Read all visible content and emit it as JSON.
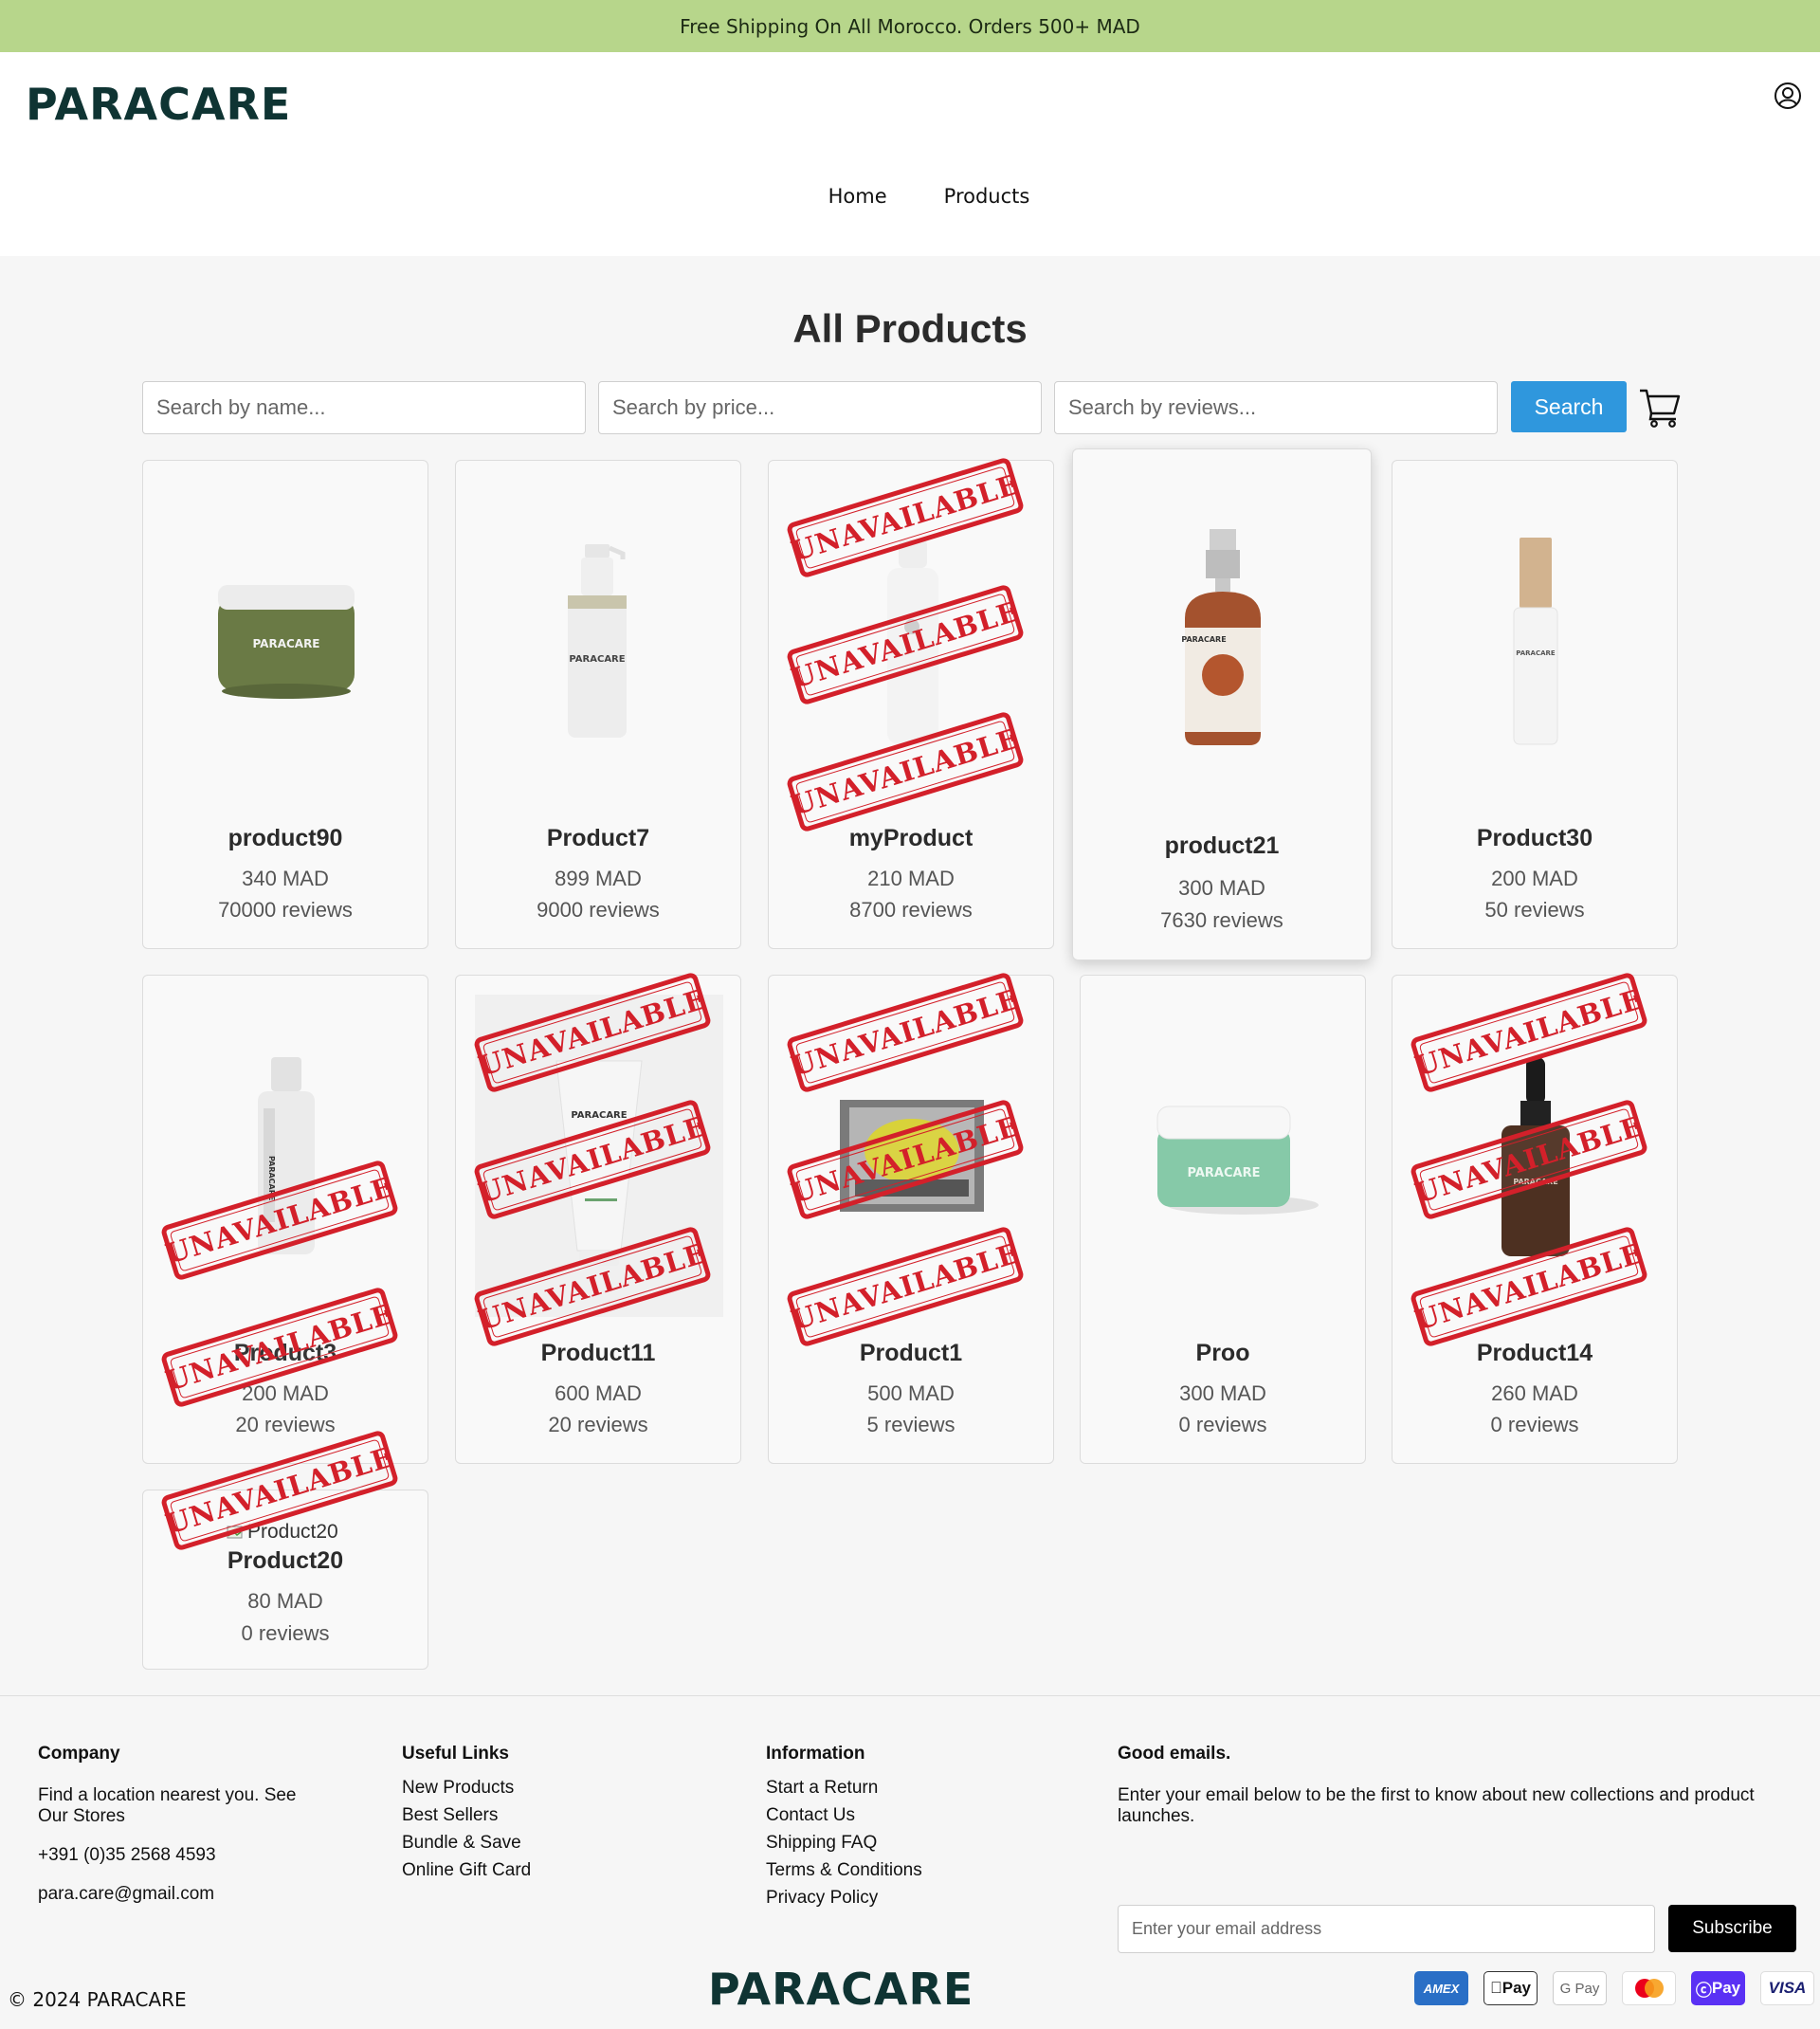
{
  "announcement": "Free Shipping On All Morocco. Orders 500+ MAD",
  "brand": {
    "logo_text": "PARACARE"
  },
  "nav": {
    "home": "Home",
    "products": "Products"
  },
  "page_title": "All Products",
  "search": {
    "name_placeholder": "Search by name...",
    "price_placeholder": "Search by price...",
    "reviews_placeholder": "Search by reviews...",
    "button": "Search"
  },
  "stamp_text": "UNAVAILABLE",
  "products": [
    {
      "name": "product90",
      "price": "340 MAD",
      "reviews": "70000 reviews",
      "unavailable": false
    },
    {
      "name": "Product7",
      "price": "899 MAD",
      "reviews": "9000 reviews",
      "unavailable": false
    },
    {
      "name": "myProduct",
      "price": "210 MAD",
      "reviews": "8700 reviews",
      "unavailable": true
    },
    {
      "name": "product21",
      "price": "300 MAD",
      "reviews": "7630 reviews",
      "unavailable": false
    },
    {
      "name": "Product30",
      "price": "200 MAD",
      "reviews": "50 reviews",
      "unavailable": false
    },
    {
      "name": "Product3",
      "price": "200 MAD",
      "reviews": "20 reviews",
      "unavailable": true
    },
    {
      "name": "Product11",
      "price": "600 MAD",
      "reviews": "20 reviews",
      "unavailable": true
    },
    {
      "name": "Product1",
      "price": "500 MAD",
      "reviews": "5 reviews",
      "unavailable": true
    },
    {
      "name": "Proo",
      "price": "300 MAD",
      "reviews": "0 reviews",
      "unavailable": false
    },
    {
      "name": "Product14",
      "price": "260 MAD",
      "reviews": "0 reviews",
      "unavailable": true
    },
    {
      "name": "Product20",
      "price": "80 MAD",
      "reviews": "0 reviews",
      "unavailable": true,
      "img_alt": "Product20"
    }
  ],
  "footer": {
    "company": {
      "heading": "Company",
      "stores": "Find a location nearest you. See Our Stores",
      "phone": "+391 (0)35 2568 4593",
      "email": "para.care@gmail.com"
    },
    "useful_links": {
      "heading": "Useful Links",
      "items": [
        "New Products",
        "Best Sellers",
        "Bundle & Save",
        "Online Gift Card"
      ]
    },
    "information": {
      "heading": "Information",
      "items": [
        "Start a Return",
        "Contact Us",
        "Shipping FAQ",
        "Terms & Conditions",
        "Privacy Policy"
      ]
    },
    "newsletter": {
      "heading": "Good emails.",
      "text": "Enter your email below to be the first to know about new collections and product launches.",
      "placeholder": "Enter your email address",
      "button": "Subscribe"
    },
    "copyright": "© 2024 PARACARE",
    "payments": [
      "AMEX",
      "Pay",
      "G Pay",
      "mastercard",
      "Pay",
      "VISA"
    ]
  },
  "colors": {
    "announcement_bg": "#b7d68b",
    "brand": "#0f3433",
    "search_button": "#2f97dd",
    "stamp": "#d3202a"
  }
}
